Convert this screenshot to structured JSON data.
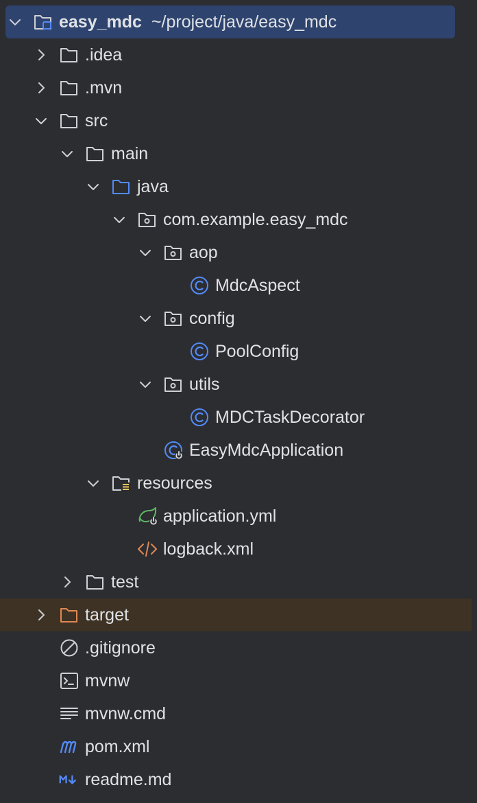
{
  "project": {
    "name": "easy_mdc",
    "path": "~/project/java/easy_mdc"
  },
  "tree": {
    "idea": ".idea",
    "mvn": ".mvn",
    "src": "src",
    "main": "main",
    "java": "java",
    "package": "com.example.easy_mdc",
    "aop": "aop",
    "mdc_aspect": "MdcAspect",
    "config": "config",
    "pool_config": "PoolConfig",
    "utils": "utils",
    "mdc_task_decorator": "MDCTaskDecorator",
    "easy_mdc_application": "EasyMdcApplication",
    "resources": "resources",
    "application_yml": "application.yml",
    "logback_xml": "logback.xml",
    "test": "test",
    "target": "target",
    "gitignore": ".gitignore",
    "mvnw": "mvnw",
    "mvnw_cmd": "mvnw.cmd",
    "pom_xml": "pom.xml",
    "readme_md": "readme.md"
  },
  "colors": {
    "background": "#2b2d30",
    "selection": "#2e436e",
    "excluded_row": "#3d3223",
    "folder_gray": "#ced0d6",
    "folder_blue": "#548af7",
    "folder_orange": "#e08855",
    "class_blue": "#548af7",
    "spring_green": "#5fb865",
    "xml_orange": "#e08855",
    "resource_yellow": "#f2c55c"
  },
  "icons": {
    "chevron_expanded": "chevron-down-icon",
    "chevron_collapsed": "chevron-right-icon",
    "folder": "folder-icon",
    "source_folder": "source-folder-icon",
    "package": "package-icon",
    "class": "class-icon",
    "spring_app": "spring-boot-class-icon",
    "spring_config": "spring-config-icon",
    "xml": "xml-icon",
    "gitignore": "ignore-file-icon",
    "shell": "shell-script-icon",
    "text": "text-file-icon",
    "maven": "maven-icon",
    "markdown": "markdown-icon",
    "module": "module-icon",
    "resources": "resources-folder-icon"
  }
}
